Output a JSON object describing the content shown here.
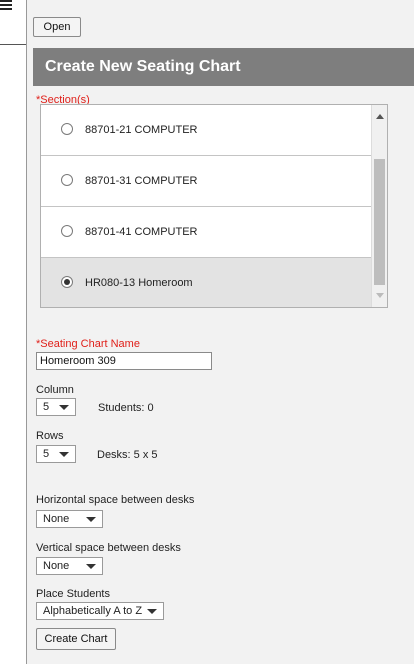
{
  "toolbar": {
    "open_label": "Open"
  },
  "header": {
    "title": "Create New Seating Chart"
  },
  "sections": {
    "required_mark": "*",
    "label": "Section(s)",
    "items": [
      {
        "label": "88701-21 COMPUTER",
        "selected": false
      },
      {
        "label": "88701-31 COMPUTER",
        "selected": false
      },
      {
        "label": "88701-41 COMPUTER",
        "selected": false
      },
      {
        "label": "HR080-13 Homeroom",
        "selected": true
      }
    ]
  },
  "chart_name": {
    "required_mark": "*",
    "label": "Seating Chart Name",
    "value": "Homeroom 309"
  },
  "column": {
    "label": "Column",
    "value": "5",
    "students_text": "Students: 0"
  },
  "rows": {
    "label": "Rows",
    "value": "5",
    "desks_text": "Desks: 5 x 5"
  },
  "horizontal_space": {
    "label": "Horizontal space between desks",
    "value": "None"
  },
  "vertical_space": {
    "label": "Vertical space between desks",
    "value": "None"
  },
  "place_students": {
    "label": "Place Students",
    "value": "Alphabetically A to Z"
  },
  "actions": {
    "create_label": "Create Chart"
  },
  "icons": {
    "menu": "hamburger-menu-icon",
    "scroll_up": "scroll-up-arrow-icon",
    "scroll_down": "scroll-down-arrow-icon",
    "dropdown": "chevron-down-icon"
  }
}
